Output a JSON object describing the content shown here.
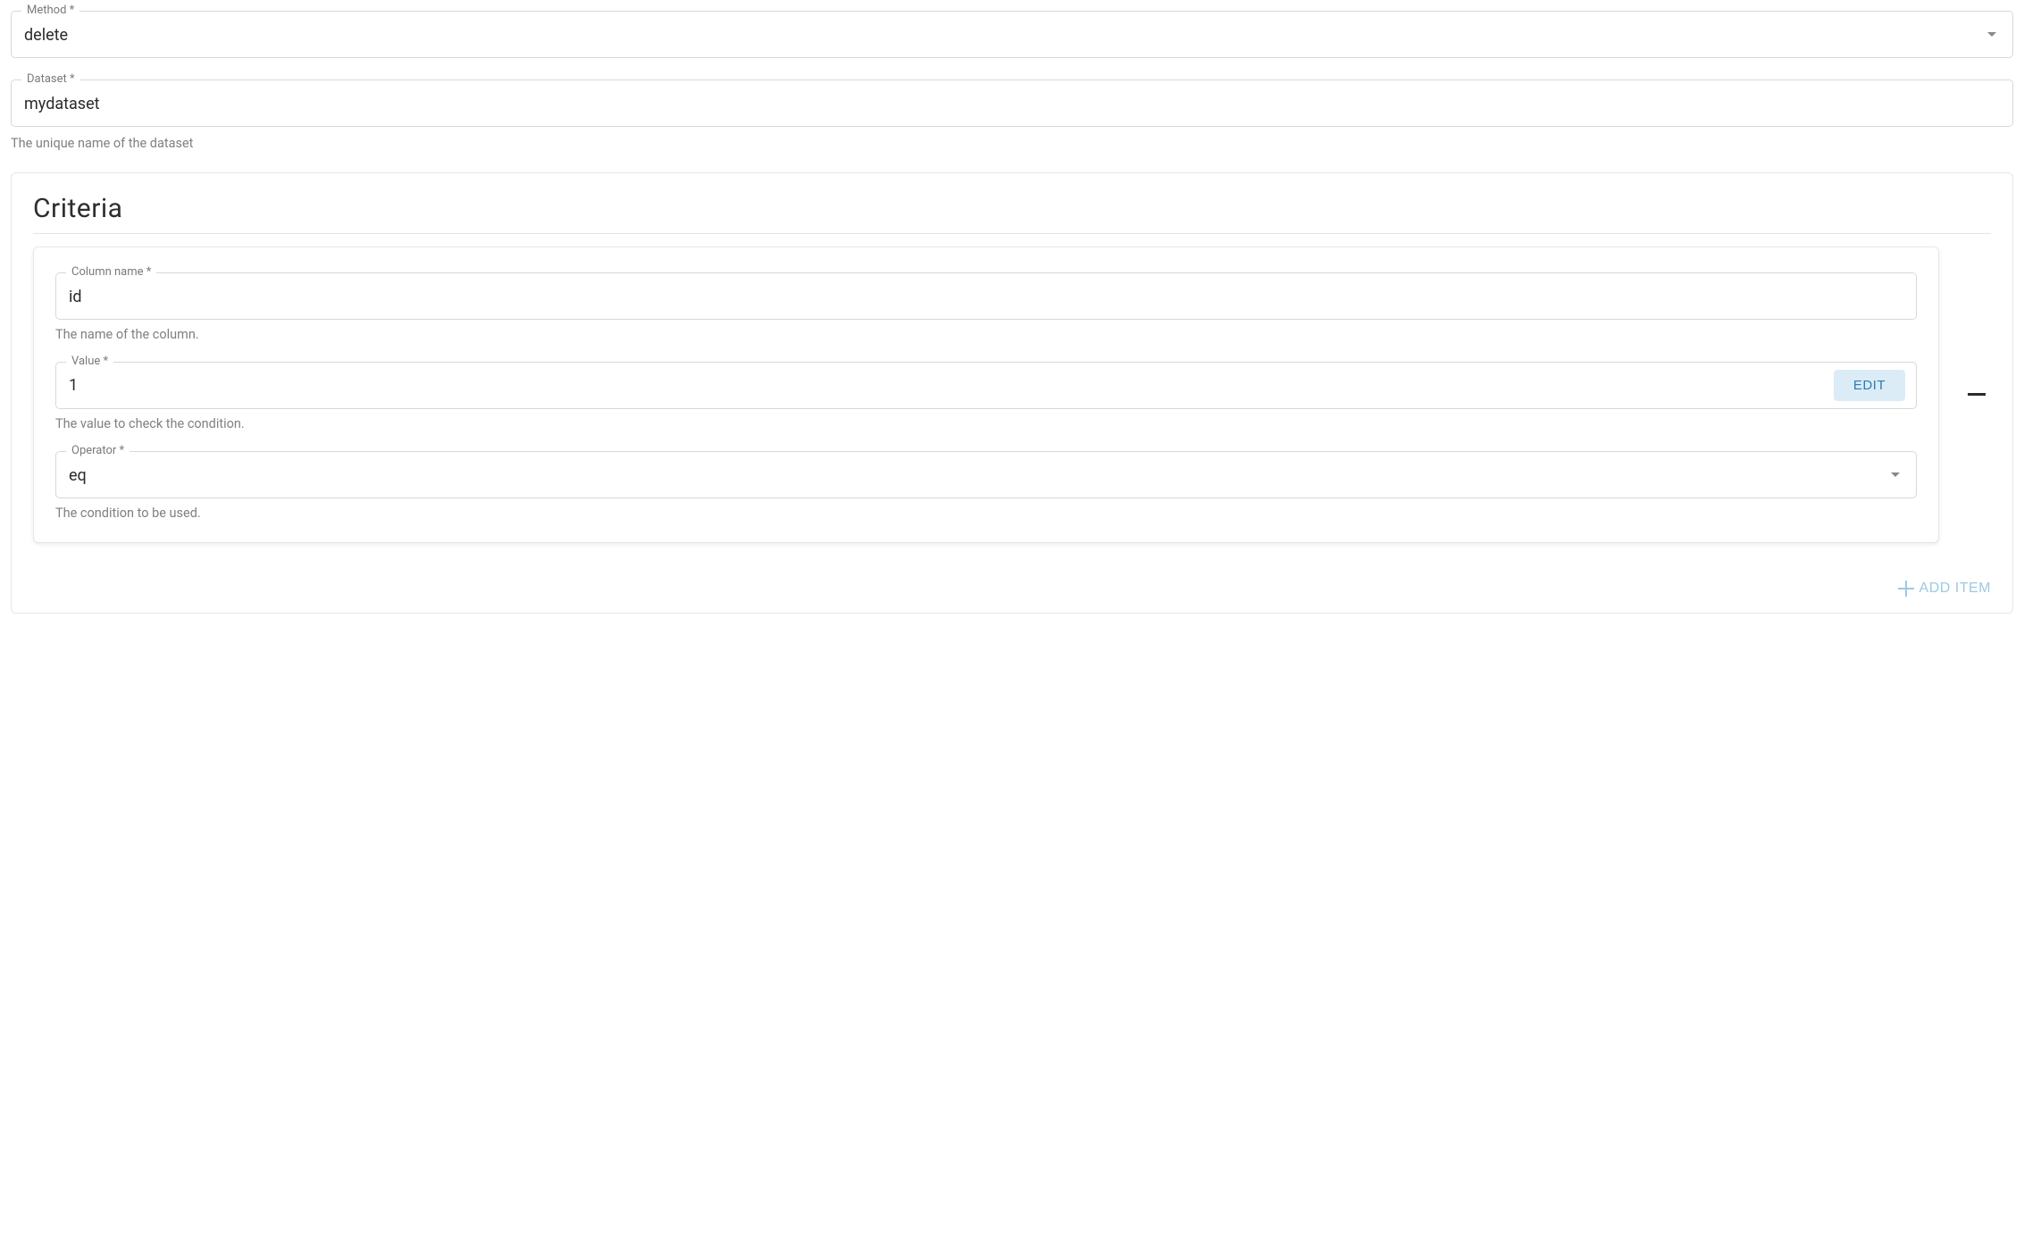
{
  "method": {
    "label": "Method *",
    "value": "delete"
  },
  "dataset": {
    "label": "Dataset *",
    "value": "mydataset",
    "helper": "The unique name of the dataset"
  },
  "criteria": {
    "title": "Criteria",
    "items": [
      {
        "column": {
          "label": "Column name *",
          "value": "id",
          "helper": "The name of the column."
        },
        "value": {
          "label": "Value *",
          "value": "1",
          "edit_label": "EDIT",
          "helper": "The value to check the condition."
        },
        "operator": {
          "label": "Operator *",
          "value": "eq",
          "helper": "The condition to be used."
        }
      }
    ],
    "add_item_label": "ADD ITEM"
  }
}
